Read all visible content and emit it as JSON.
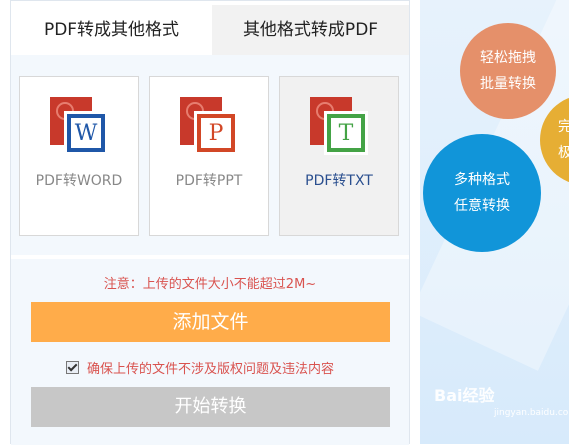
{
  "tabs": [
    {
      "label": "PDF转成其他格式",
      "active": true
    },
    {
      "label": "其他格式转成PDF",
      "active": false
    }
  ],
  "cards": [
    {
      "label": "PDF转WORD",
      "icon": "pdf-to-word-icon",
      "badge_letter": "W"
    },
    {
      "label": "PDF转PPT",
      "icon": "pdf-to-ppt-icon",
      "badge_letter": "P"
    },
    {
      "label": "PDF转TXT",
      "icon": "pdf-to-txt-icon",
      "badge_letter": "T",
      "selected": true
    }
  ],
  "upload": {
    "notice": "注意：上传的文件大小不能超过2M~",
    "add_label": "添加文件",
    "agree_text": "确保上传的文件不涉及版权问题及违法内容",
    "agree_checked": true,
    "start_label": "开始转换"
  },
  "promo": {
    "bubble_orange": [
      "轻松拖拽",
      "批量转换"
    ],
    "bubble_blue": [
      "多种格式",
      "任意转换"
    ],
    "bubble_yellow": [
      "完",
      "极"
    ]
  },
  "watermark": {
    "text": "Bai经验",
    "sub": "jingyan.baidu.com"
  },
  "colors": {
    "accent_orange": "#ffac4a",
    "notice_red": "#d9534f",
    "button_disabled": "#c7c7c7",
    "bubble_blue": "#1195d9",
    "bubble_orange": "#e5906a",
    "bubble_yellow": "#e6ae34"
  }
}
